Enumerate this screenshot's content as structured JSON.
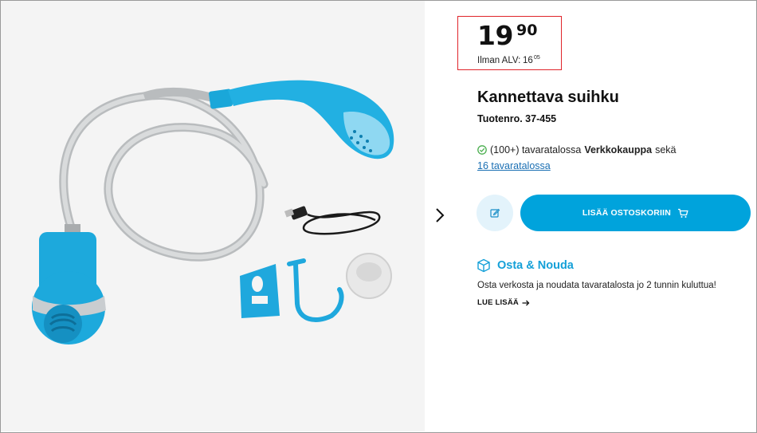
{
  "product": {
    "price": {
      "whole": "19",
      "cents": "90"
    },
    "vat": {
      "label": "Ilman ALV:",
      "whole": "16",
      "cents": "05"
    },
    "title": "Kannettava suihku",
    "sku": "Tuotenro. 37-455"
  },
  "availability": {
    "text_prefix": "(100+) tavaratalossa",
    "text_bold": "Verkkokauppa",
    "text_suffix": "sekä",
    "store_link": "16 tavaratalossa"
  },
  "actions": {
    "add_to_cart": "LISÄÄ OSTOSKORIIN"
  },
  "click_collect": {
    "title": "Osta & Nouda",
    "description": "Osta verkosta ja noudata tavaratalosta jo 2 tunnin kuluttua!",
    "read_more": "LUE LISÄÄ"
  },
  "icons": {
    "next": "chevron-right-icon",
    "check": "check-circle-icon",
    "edit": "edit-icon",
    "cart": "cart-icon",
    "box": "box-icon",
    "arrow": "arrow-right-icon"
  },
  "colors": {
    "accent": "#00a3dc",
    "accent_light": "#e3f3fb",
    "highlight_border": "#e0242a",
    "link": "#1a6fb3",
    "success": "#4caf50"
  }
}
